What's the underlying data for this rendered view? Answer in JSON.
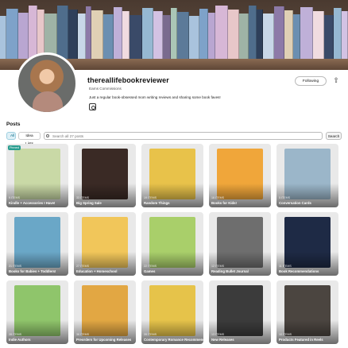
{
  "profile": {
    "username": "thereallifebookreviewer",
    "subtitle": "Earns Commissions",
    "bio": "Just a regular book-obsessed mom writing reviews and sharing some book faves!",
    "follow_label": "Following",
    "avatar_icon": "avatar",
    "instagram_icon": "instagram-icon",
    "share_icon": "share-icon"
  },
  "posts": {
    "title": "Posts",
    "tabs": [
      {
        "label": "All"
      },
      {
        "label": "Idea Lists"
      }
    ],
    "search_placeholder": "Search all 27 posts",
    "search_button": "Search",
    "cards": [
      {
        "title": "Kindle + Accessories I Have!",
        "count": "9 ITEMS",
        "badge": "Pinned",
        "art": "#c9d9a6"
      },
      {
        "title": "Big Spring Sale",
        "count": "33 ITEMS",
        "art": "#3a2a25"
      },
      {
        "title": "Random Things",
        "count": "19 ITEMS",
        "art": "#e8c24a"
      },
      {
        "title": "Books for Kids!",
        "count": "16 ITEMS",
        "art": "#f0a63a"
      },
      {
        "title": "Conversation Cards",
        "count": "5 ITEMS",
        "art": "#9bb6c9"
      },
      {
        "title": "Books for Babies + Toddlers!",
        "count": "21 ITEMS",
        "art": "#6aa7c7"
      },
      {
        "title": "Education + Homeschool",
        "count": "27 ITEMS",
        "art": "#f1c65a"
      },
      {
        "title": "Games",
        "count": "22 ITEMS",
        "art": "#a9cf6a"
      },
      {
        "title": "Reading Bullet Journal",
        "count": "12 ITEMS",
        "art": "#6e6e6e"
      },
      {
        "title": "Book Recommendations",
        "count": "11 ITEMS",
        "art": "#1e2a45"
      },
      {
        "title": "Indie Authors",
        "count": "28 ITEMS",
        "art": "#8fc56b"
      },
      {
        "title": "Preorders for Upcoming Releases",
        "count": "36 ITEMS",
        "art": "#e2a743"
      },
      {
        "title": "Contemporary Romance Recommendations",
        "count": "39 ITEMS",
        "art": "#e6c34a"
      },
      {
        "title": "New Releases",
        "count": "13 ITEMS",
        "art": "#3b3b3b"
      },
      {
        "title": "Products Featured in Reels",
        "count": "10 ITEMS",
        "art": "#4b4540"
      }
    ]
  }
}
